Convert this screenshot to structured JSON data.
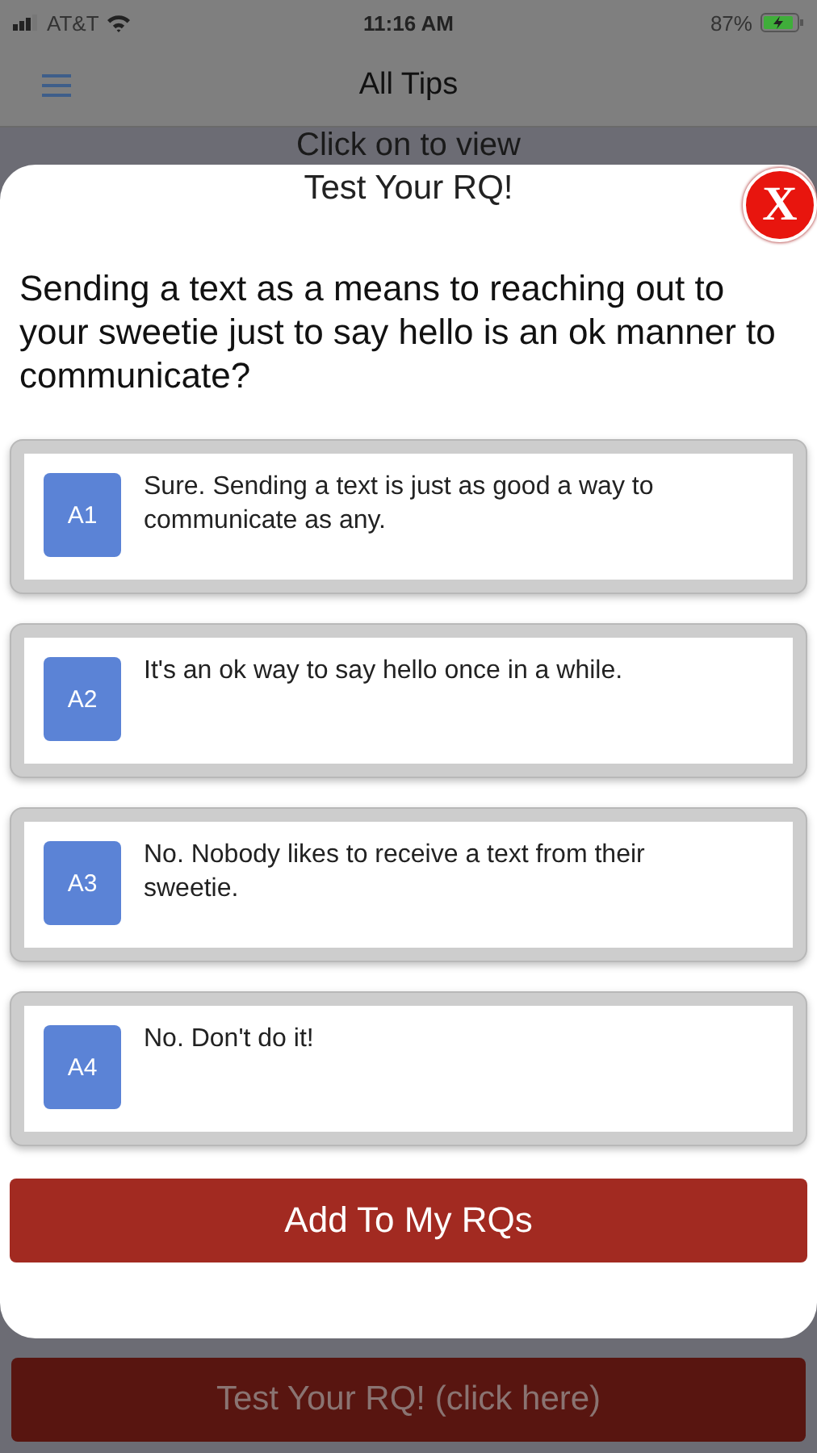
{
  "status_bar": {
    "carrier": "AT&T",
    "time": "11:16 AM",
    "battery": "87%"
  },
  "nav": {
    "title": "All Tips"
  },
  "background": {
    "hint": "Click on to view",
    "button": "Test Your RQ! (click here)"
  },
  "modal": {
    "title": "Test Your RQ!",
    "close": "X",
    "question": "Sending a text as a means to reaching out to your sweetie just to say hello is an ok manner to communicate?",
    "answers": [
      {
        "badge": "A1",
        "text": "Sure. Sending a text is just as good a way to communicate as any."
      },
      {
        "badge": "A2",
        "text": "It's an ok way to say hello once in a while."
      },
      {
        "badge": "A3",
        "text": "No. Nobody likes to receive a text from their sweetie."
      },
      {
        "badge": "A4",
        "text": "No. Don't do it!"
      }
    ],
    "button": "Add To My RQs"
  }
}
